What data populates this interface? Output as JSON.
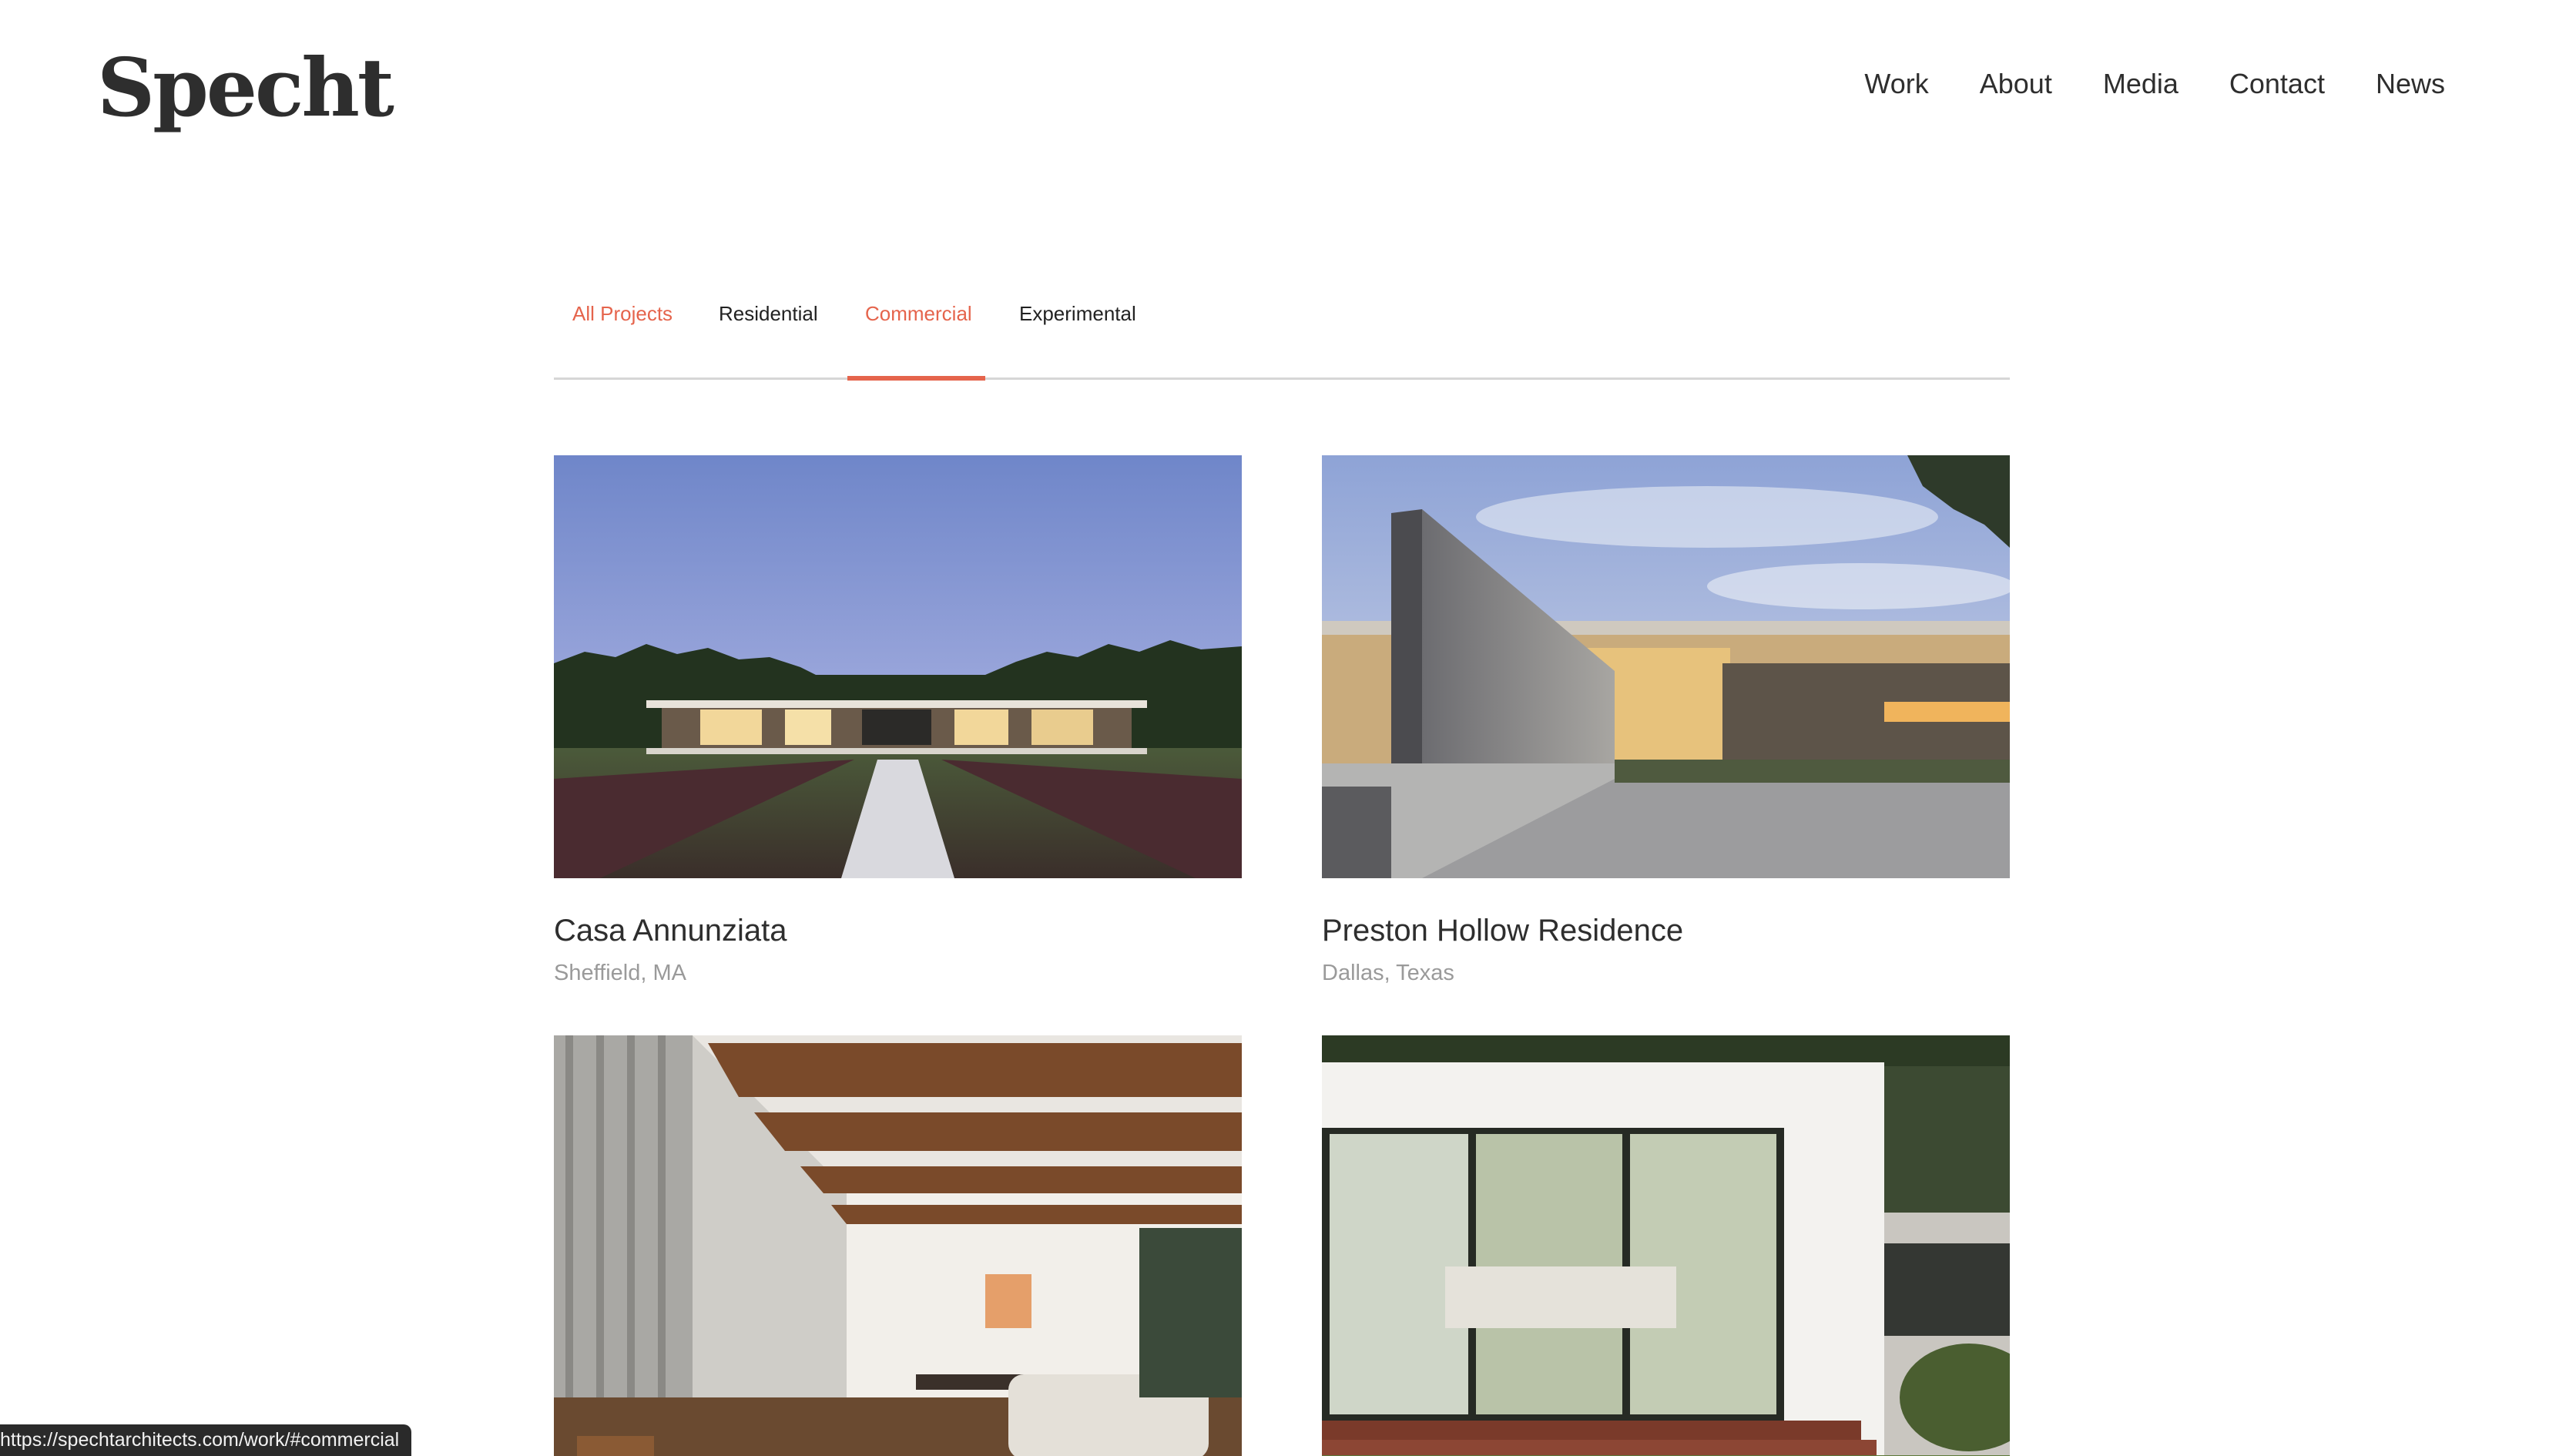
{
  "header": {
    "logo": "Specht",
    "nav": [
      "Work",
      "About",
      "Media",
      "Contact",
      "News"
    ]
  },
  "filters": {
    "tabs": [
      "All Projects",
      "Residential",
      "Commercial",
      "Experimental"
    ],
    "active": "Commercial"
  },
  "projects": [
    {
      "title": "Casa Annunziata",
      "location": "Sheffield, MA"
    },
    {
      "title": "Preston Hollow Residence",
      "location": "Dallas, Texas"
    },
    {
      "title": "",
      "location": ""
    },
    {
      "title": "",
      "location": ""
    }
  ],
  "status_bar": {
    "url": "https://spechtarchitects.com/work/#commercial"
  },
  "colors": {
    "accent": "#e5644c",
    "text": "#2e2e2e",
    "muted": "#9a9a9a",
    "divider": "#d6d6d6"
  }
}
